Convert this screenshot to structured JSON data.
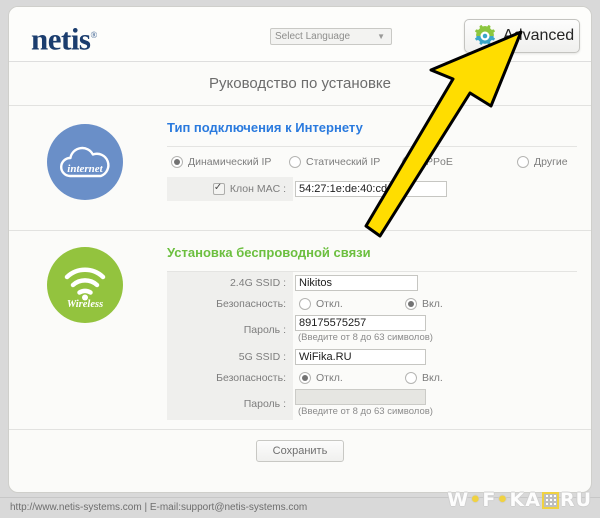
{
  "brand": {
    "logo_text": "netis",
    "registered_mark": "®"
  },
  "header": {
    "language_select_value": "Select Language",
    "language_caret": "▼",
    "advanced_button_label": "Advanced",
    "gear_icon": "gear-icon",
    "gear_color_green": "#8cc63f",
    "gear_color_teal": "#3aa6c9"
  },
  "page": {
    "title": "Руководство по установке"
  },
  "internet_section": {
    "icon_name": "internet-cloud-icon",
    "icon_label": "internet",
    "icon_color": "#6a8fc8",
    "heading": "Тип подключения к Интернету",
    "heading_color": "#2a7ade",
    "connection_options": [
      {
        "label": "Динамический IP",
        "selected": true
      },
      {
        "label": "Статический IP",
        "selected": false
      },
      {
        "label": "PPPoE",
        "selected": false
      },
      {
        "label": "Другие",
        "selected": false
      }
    ],
    "mac_clone": {
      "label": "Клон MAC :",
      "checked": true,
      "value": "54:27:1e:de:40:cd"
    }
  },
  "wireless_section": {
    "icon_name": "wireless-wifi-icon",
    "icon_label": "Wireless",
    "icon_color": "#93c33e",
    "heading": "Установка беспроводной связи",
    "heading_color": "#6cbf3f",
    "ssid_24g": {
      "label": "2.4G SSID :",
      "value": "Nikitos"
    },
    "security_24g": {
      "label": "Безопасность:",
      "off_label": "Откл.",
      "on_label": "Вкл.",
      "selected": "on"
    },
    "password_24g": {
      "label": "Пароль :",
      "value": "89175575257",
      "hint": "(Введите от 8 до 63 символов)",
      "disabled": false
    },
    "ssid_5g": {
      "label": "5G SSID :",
      "value": "WiFika.RU"
    },
    "security_5g": {
      "label": "Безопасность:",
      "off_label": "Откл.",
      "on_label": "Вкл.",
      "selected": "off"
    },
    "password_5g": {
      "label": "Пароль :",
      "value": "",
      "hint": "(Введите от 8 до 63 символов)",
      "disabled": true
    }
  },
  "actions": {
    "save_label": "Сохранить"
  },
  "footer": {
    "text": "http://www.netis-systems.com | E-mail:support@netis-systems.com"
  },
  "watermark": {
    "part1": "W",
    "part2": "F",
    "part3": "KA",
    "part4": "RU",
    "dot": "•",
    "qr_icon": "qr-code-icon"
  },
  "annotation": {
    "arrow_name": "yellow-arrow-annotation",
    "arrow_color": "#FFDD00",
    "arrow_outline": "#000000"
  }
}
